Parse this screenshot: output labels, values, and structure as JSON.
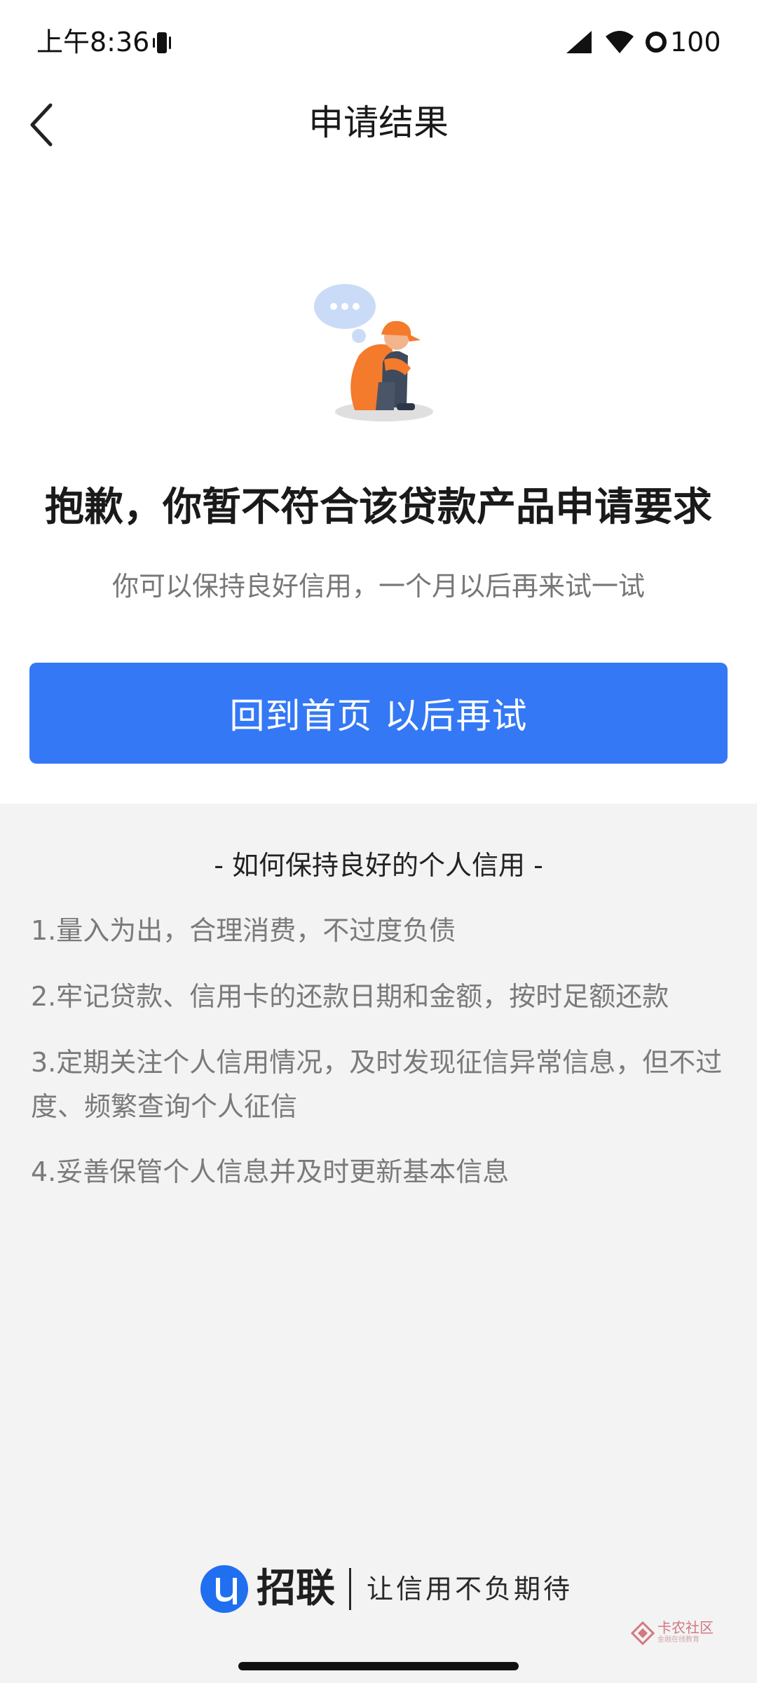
{
  "status_bar": {
    "time": "上午8:36",
    "battery": "100"
  },
  "nav": {
    "title": "申请结果"
  },
  "result": {
    "headline": "抱歉，你暂不符合该贷款产品申请要求",
    "subline": "你可以保持良好信用，一个月以后再来试一试",
    "button_label": "回到首页 以后再试"
  },
  "tips": {
    "title": "- 如何保持良好的个人信用 -",
    "items": [
      "1.量入为出，合理消费，不过度负债",
      "2.牢记贷款、信用卡的还款日期和金额，按时足额还款",
      "3.定期关注个人信用情况，及时发现征信异常信息，但不过度、频繁查询个人征信",
      "4.妥善保管个人信息并及时更新基本信息"
    ]
  },
  "footer": {
    "brand_name": "招联",
    "slogan": "让信用不负期待"
  },
  "watermark": {
    "title": "卡农社区",
    "subtitle": "金融在线教育"
  },
  "colors": {
    "primary": "#3478f6",
    "illustration_shirt": "#f47a2c",
    "illustration_pants": "#3f4a5c",
    "bubble": "#c9dbf7"
  }
}
